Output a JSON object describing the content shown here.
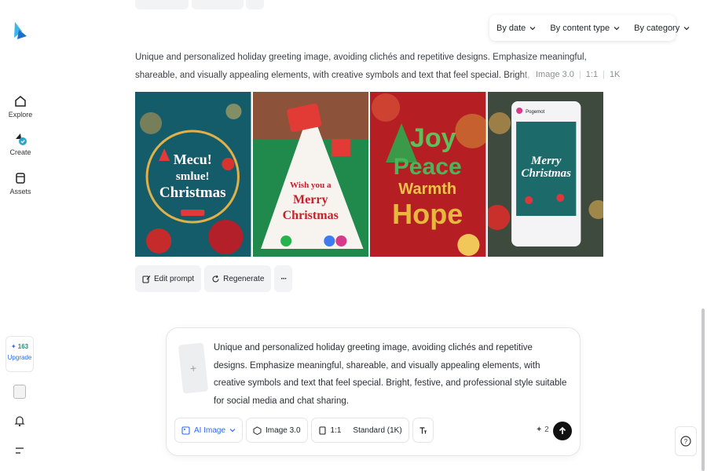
{
  "sidebar": {
    "items": [
      {
        "label": "Explore",
        "icon": "home-icon"
      },
      {
        "label": "Create",
        "icon": "create-icon"
      },
      {
        "label": "Assets",
        "icon": "folder-icon"
      }
    ],
    "credits": {
      "count": "163",
      "upgrade_label": "Upgrade"
    }
  },
  "filters": {
    "by_date": "By date",
    "by_content_type": "By content type",
    "by_category": "By category"
  },
  "generation": {
    "prompt": "Unique and personalized holiday greeting image, avoiding clichés and repetitive designs. Emphasize meaningful, shareable, and visually appealing elements, with creative symbols and text that feel special. Bright, festive, and professional style suitable for social media and chat sharing.",
    "model": "Image 3.0",
    "ratio": "1:1",
    "resolution": "1K",
    "images": [
      {
        "text": [
          "Mecu!",
          "smlue!",
          "Christmas"
        ]
      },
      {
        "text": [
          "Wish you a",
          "Merry",
          "Christmas"
        ]
      },
      {
        "text": [
          "Joy",
          "Peace",
          "Warmth",
          "Hope"
        ]
      },
      {
        "text": [
          "Pogemot",
          "Merry",
          "Christmas"
        ]
      }
    ],
    "actions": {
      "edit": "Edit prompt",
      "regenerate": "Regenerate",
      "more": "···"
    }
  },
  "composer": {
    "text": "Unique and personalized holiday greeting image, avoiding clichés and repetitive designs. Emphasize meaningful, shareable, and visually appealing elements, with creative symbols and text that feel special. Bright, festive, and professional style suitable for social media and chat sharing.",
    "mode": "AI Image",
    "model": "Image 3.0",
    "ratio": "1:1",
    "quality": "Standard (1K)",
    "cost": "2"
  },
  "colors": {
    "accent": "#2d6bf0",
    "teal": "#2a8c7a",
    "send": "#111111"
  }
}
